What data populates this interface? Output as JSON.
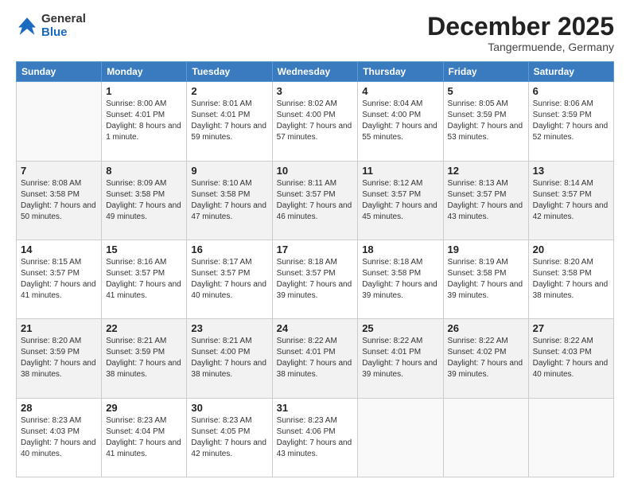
{
  "header": {
    "logo_general": "General",
    "logo_blue": "Blue",
    "month_title": "December 2025",
    "subtitle": "Tangermuende, Germany"
  },
  "days_of_week": [
    "Sunday",
    "Monday",
    "Tuesday",
    "Wednesday",
    "Thursday",
    "Friday",
    "Saturday"
  ],
  "weeks": [
    [
      {
        "day": "",
        "sunrise": "",
        "sunset": "",
        "daylight": ""
      },
      {
        "day": "1",
        "sunrise": "Sunrise: 8:00 AM",
        "sunset": "Sunset: 4:01 PM",
        "daylight": "Daylight: 8 hours and 1 minute."
      },
      {
        "day": "2",
        "sunrise": "Sunrise: 8:01 AM",
        "sunset": "Sunset: 4:01 PM",
        "daylight": "Daylight: 7 hours and 59 minutes."
      },
      {
        "day": "3",
        "sunrise": "Sunrise: 8:02 AM",
        "sunset": "Sunset: 4:00 PM",
        "daylight": "Daylight: 7 hours and 57 minutes."
      },
      {
        "day": "4",
        "sunrise": "Sunrise: 8:04 AM",
        "sunset": "Sunset: 4:00 PM",
        "daylight": "Daylight: 7 hours and 55 minutes."
      },
      {
        "day": "5",
        "sunrise": "Sunrise: 8:05 AM",
        "sunset": "Sunset: 3:59 PM",
        "daylight": "Daylight: 7 hours and 53 minutes."
      },
      {
        "day": "6",
        "sunrise": "Sunrise: 8:06 AM",
        "sunset": "Sunset: 3:59 PM",
        "daylight": "Daylight: 7 hours and 52 minutes."
      }
    ],
    [
      {
        "day": "7",
        "sunrise": "Sunrise: 8:08 AM",
        "sunset": "Sunset: 3:58 PM",
        "daylight": "Daylight: 7 hours and 50 minutes."
      },
      {
        "day": "8",
        "sunrise": "Sunrise: 8:09 AM",
        "sunset": "Sunset: 3:58 PM",
        "daylight": "Daylight: 7 hours and 49 minutes."
      },
      {
        "day": "9",
        "sunrise": "Sunrise: 8:10 AM",
        "sunset": "Sunset: 3:58 PM",
        "daylight": "Daylight: 7 hours and 47 minutes."
      },
      {
        "day": "10",
        "sunrise": "Sunrise: 8:11 AM",
        "sunset": "Sunset: 3:57 PM",
        "daylight": "Daylight: 7 hours and 46 minutes."
      },
      {
        "day": "11",
        "sunrise": "Sunrise: 8:12 AM",
        "sunset": "Sunset: 3:57 PM",
        "daylight": "Daylight: 7 hours and 45 minutes."
      },
      {
        "day": "12",
        "sunrise": "Sunrise: 8:13 AM",
        "sunset": "Sunset: 3:57 PM",
        "daylight": "Daylight: 7 hours and 43 minutes."
      },
      {
        "day": "13",
        "sunrise": "Sunrise: 8:14 AM",
        "sunset": "Sunset: 3:57 PM",
        "daylight": "Daylight: 7 hours and 42 minutes."
      }
    ],
    [
      {
        "day": "14",
        "sunrise": "Sunrise: 8:15 AM",
        "sunset": "Sunset: 3:57 PM",
        "daylight": "Daylight: 7 hours and 41 minutes."
      },
      {
        "day": "15",
        "sunrise": "Sunrise: 8:16 AM",
        "sunset": "Sunset: 3:57 PM",
        "daylight": "Daylight: 7 hours and 41 minutes."
      },
      {
        "day": "16",
        "sunrise": "Sunrise: 8:17 AM",
        "sunset": "Sunset: 3:57 PM",
        "daylight": "Daylight: 7 hours and 40 minutes."
      },
      {
        "day": "17",
        "sunrise": "Sunrise: 8:18 AM",
        "sunset": "Sunset: 3:57 PM",
        "daylight": "Daylight: 7 hours and 39 minutes."
      },
      {
        "day": "18",
        "sunrise": "Sunrise: 8:18 AM",
        "sunset": "Sunset: 3:58 PM",
        "daylight": "Daylight: 7 hours and 39 minutes."
      },
      {
        "day": "19",
        "sunrise": "Sunrise: 8:19 AM",
        "sunset": "Sunset: 3:58 PM",
        "daylight": "Daylight: 7 hours and 39 minutes."
      },
      {
        "day": "20",
        "sunrise": "Sunrise: 8:20 AM",
        "sunset": "Sunset: 3:58 PM",
        "daylight": "Daylight: 7 hours and 38 minutes."
      }
    ],
    [
      {
        "day": "21",
        "sunrise": "Sunrise: 8:20 AM",
        "sunset": "Sunset: 3:59 PM",
        "daylight": "Daylight: 7 hours and 38 minutes."
      },
      {
        "day": "22",
        "sunrise": "Sunrise: 8:21 AM",
        "sunset": "Sunset: 3:59 PM",
        "daylight": "Daylight: 7 hours and 38 minutes."
      },
      {
        "day": "23",
        "sunrise": "Sunrise: 8:21 AM",
        "sunset": "Sunset: 4:00 PM",
        "daylight": "Daylight: 7 hours and 38 minutes."
      },
      {
        "day": "24",
        "sunrise": "Sunrise: 8:22 AM",
        "sunset": "Sunset: 4:01 PM",
        "daylight": "Daylight: 7 hours and 38 minutes."
      },
      {
        "day": "25",
        "sunrise": "Sunrise: 8:22 AM",
        "sunset": "Sunset: 4:01 PM",
        "daylight": "Daylight: 7 hours and 39 minutes."
      },
      {
        "day": "26",
        "sunrise": "Sunrise: 8:22 AM",
        "sunset": "Sunset: 4:02 PM",
        "daylight": "Daylight: 7 hours and 39 minutes."
      },
      {
        "day": "27",
        "sunrise": "Sunrise: 8:22 AM",
        "sunset": "Sunset: 4:03 PM",
        "daylight": "Daylight: 7 hours and 40 minutes."
      }
    ],
    [
      {
        "day": "28",
        "sunrise": "Sunrise: 8:23 AM",
        "sunset": "Sunset: 4:03 PM",
        "daylight": "Daylight: 7 hours and 40 minutes."
      },
      {
        "day": "29",
        "sunrise": "Sunrise: 8:23 AM",
        "sunset": "Sunset: 4:04 PM",
        "daylight": "Daylight: 7 hours and 41 minutes."
      },
      {
        "day": "30",
        "sunrise": "Sunrise: 8:23 AM",
        "sunset": "Sunset: 4:05 PM",
        "daylight": "Daylight: 7 hours and 42 minutes."
      },
      {
        "day": "31",
        "sunrise": "Sunrise: 8:23 AM",
        "sunset": "Sunset: 4:06 PM",
        "daylight": "Daylight: 7 hours and 43 minutes."
      },
      {
        "day": "",
        "sunrise": "",
        "sunset": "",
        "daylight": ""
      },
      {
        "day": "",
        "sunrise": "",
        "sunset": "",
        "daylight": ""
      },
      {
        "day": "",
        "sunrise": "",
        "sunset": "",
        "daylight": ""
      }
    ]
  ]
}
